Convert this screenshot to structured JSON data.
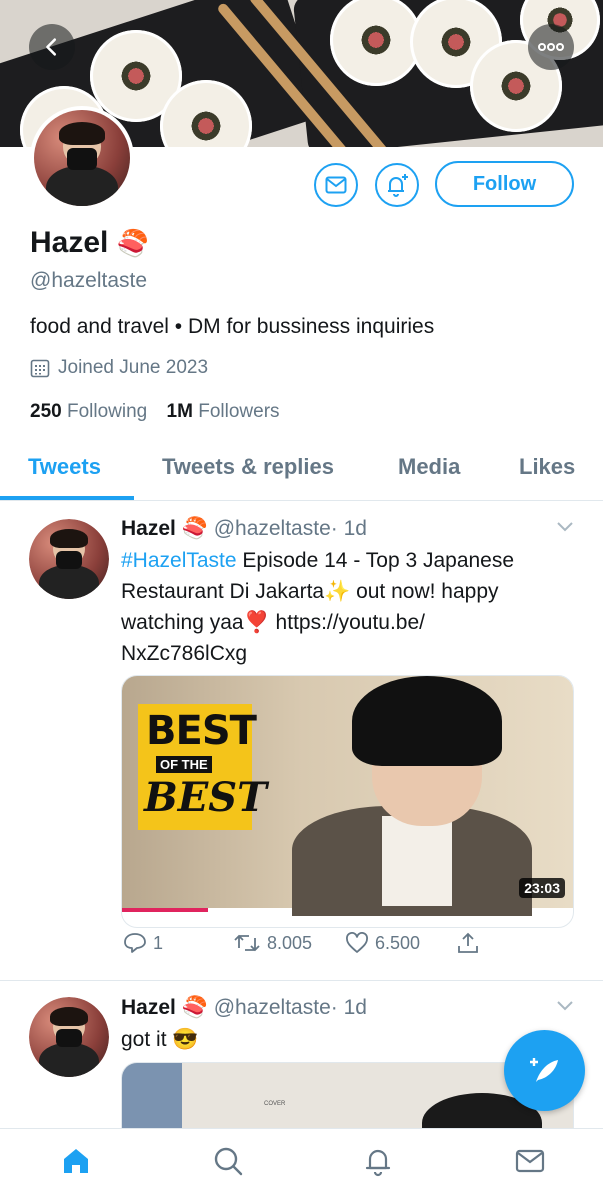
{
  "profile": {
    "name": "Hazel",
    "name_emoji": "🍣",
    "handle": "@hazeltaste",
    "bio": "food and travel • DM for bussiness inquiries",
    "joined": "Joined June 2023",
    "following_count": "250",
    "following_label": "Following",
    "followers_count": "1M",
    "followers_label": "Followers",
    "follow_label": "Follow"
  },
  "tabs": [
    {
      "label": "Tweets",
      "active": true
    },
    {
      "label": "Tweets & replies"
    },
    {
      "label": "Media"
    },
    {
      "label": "Likes"
    }
  ],
  "tweets": [
    {
      "name": "Hazel",
      "emoji": "🍣",
      "handle": "@hazeltaste",
      "time": "· 1d",
      "hashtag": "#HazelTaste",
      "text1": " Episode 14 - Top 3 Japanese Restaurant Di Jakarta✨ out now! happy watching yaa❣️ https://youtu.be/",
      "text2": "NxZc786lCxg",
      "media": {
        "best_line1": "BEST",
        "best_line2": "OF THE",
        "best_line3": "BEST",
        "duration": "23:03",
        "progress": 0.19
      },
      "replies": "1",
      "retweets": "8.005",
      "likes": "6.500"
    },
    {
      "name": "Hazel",
      "emoji": "🍣",
      "handle": "@hazeltaste",
      "time": "· 1d",
      "text": "got it 😎",
      "media_label": "COVER"
    }
  ],
  "colors": {
    "accent": "#1da1f2",
    "muted": "#657786",
    "divider": "#e1e8ed"
  },
  "icons": {
    "back": "back-arrow-icon",
    "more": "more-icon",
    "mail": "mail-icon",
    "notify": "bell-plus-icon",
    "calendar": "calendar-icon",
    "reply": "reply-icon",
    "retweet": "retweet-icon",
    "like": "heart-icon",
    "share": "share-icon",
    "compose": "compose-icon",
    "home": "home-icon",
    "search": "search-icon",
    "notifications": "bell-icon",
    "messages": "messages-icon"
  }
}
